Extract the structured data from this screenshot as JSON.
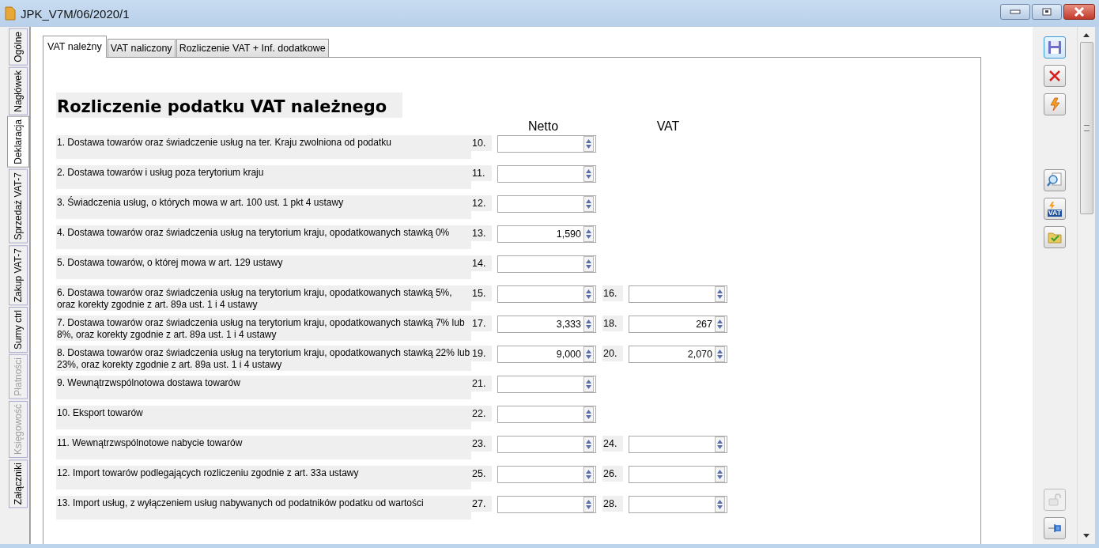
{
  "window": {
    "title": "JPK_V7M/06/2020/1"
  },
  "side_tabs": [
    {
      "label": "Ogólne",
      "selected": false,
      "disabled": false
    },
    {
      "label": "Nagłówek",
      "selected": false,
      "disabled": false
    },
    {
      "label": "Deklaracja",
      "selected": true,
      "disabled": false
    },
    {
      "label": "Sprzedaż VAT-7",
      "selected": false,
      "disabled": false
    },
    {
      "label": "Zakup VAT-7",
      "selected": false,
      "disabled": false
    },
    {
      "label": "Sumy ctrl",
      "selected": false,
      "disabled": false
    },
    {
      "label": "Płatności",
      "selected": false,
      "disabled": true
    },
    {
      "label": "Księgowość",
      "selected": false,
      "disabled": true
    },
    {
      "label": "Załączniki",
      "selected": false,
      "disabled": false
    }
  ],
  "tabs": [
    {
      "label": "VAT należny",
      "selected": true
    },
    {
      "label": "VAT naliczony",
      "selected": false
    },
    {
      "label": "Rozliczenie VAT + Inf. dodatkowe",
      "selected": false
    }
  ],
  "heading": "Rozliczenie podatku VAT należnego",
  "column_headers": [
    "Netto",
    "VAT"
  ],
  "rows": [
    {
      "label": "1. Dostawa towarów oraz świadczenie usług na ter. Kraju zwolniona od podatku",
      "fields": [
        {
          "number": "10."
        }
      ]
    },
    {
      "label": "2. Dostawa towarów i usług poza terytorium kraju",
      "fields": [
        {
          "number": "11."
        }
      ]
    },
    {
      "label": "3. Świadczenia usług, o których mowa w art. 100 ust. 1 pkt 4 ustawy",
      "fields": [
        {
          "number": "12."
        }
      ]
    },
    {
      "label": "4. Dostawa towarów oraz świadczenia usług na terytorium kraju,  opodatkowanych stawką 0%",
      "fields": [
        {
          "number": "13.",
          "value": "1,590"
        }
      ]
    },
    {
      "label": "5. Dostawa towarów, o której mowa w art. 129 ustawy",
      "fields": [
        {
          "number": "14."
        }
      ]
    },
    {
      "label": "6. Dostawa towarów oraz świadczenia usług na terytorium kraju, opodatkowanych stawką 5%, oraz korekty zgodnie z art. 89a ust. 1 i 4 ustawy",
      "fields": [
        {
          "number": "15."
        },
        {
          "number": "16."
        }
      ]
    },
    {
      "label": "7. Dostawa towarów oraz świadczenia usług na terytorium kraju, opodatkowanych stawką 7% lub 8%, oraz korekty zgodnie z art. 89a ust. 1 i 4 ustawy",
      "fields": [
        {
          "number": "17.",
          "value": "3,333"
        },
        {
          "number": "18.",
          "value": "267"
        }
      ]
    },
    {
      "label": "8. Dostawa towarów oraz świadczenia usług na terytorium kraju, opodatkowanych stawką 22% lub 23%, oraz korekty zgodnie z art. 89a ust. 1 i 4 ustawy",
      "fields": [
        {
          "number": "19.",
          "value": "9,000"
        },
        {
          "number": "20.",
          "value": "2,070"
        }
      ]
    },
    {
      "label": "9. Wewnątrzwspólnotowa dostawa towarów",
      "fields": [
        {
          "number": "21."
        }
      ]
    },
    {
      "label": "10. Eksport towarów",
      "fields": [
        {
          "number": "22."
        }
      ]
    },
    {
      "label": "11. Wewnątrzwspólnotowe nabycie towarów",
      "fields": [
        {
          "number": "23."
        },
        {
          "number": "24."
        }
      ]
    },
    {
      "label": "12. Import towarów podlegających rozliczeniu zgodnie z art. 33a ustawy",
      "fields": [
        {
          "number": "25."
        },
        {
          "number": "26."
        }
      ]
    },
    {
      "label": "13. Import usług, z wyłączeniem usług nabywanych od podatników podatku od wartości",
      "fields": [
        {
          "number": "27."
        },
        {
          "number": "28."
        }
      ]
    }
  ],
  "toolbar": [
    {
      "kind": "save",
      "disabled": false,
      "selected": true
    },
    {
      "kind": "cancel",
      "disabled": false,
      "selected": false
    },
    {
      "kind": "lightning",
      "disabled": false,
      "selected": false
    },
    {
      "kind": "gap"
    },
    {
      "kind": "preview",
      "disabled": false,
      "selected": false
    },
    {
      "kind": "vat",
      "text": "VAT",
      "disabled": false,
      "selected": false
    },
    {
      "kind": "folder",
      "disabled": false,
      "selected": false
    },
    {
      "kind": "spacer"
    },
    {
      "kind": "lock",
      "disabled": true,
      "selected": false
    },
    {
      "kind": "pin",
      "disabled": false,
      "selected": false
    }
  ]
}
